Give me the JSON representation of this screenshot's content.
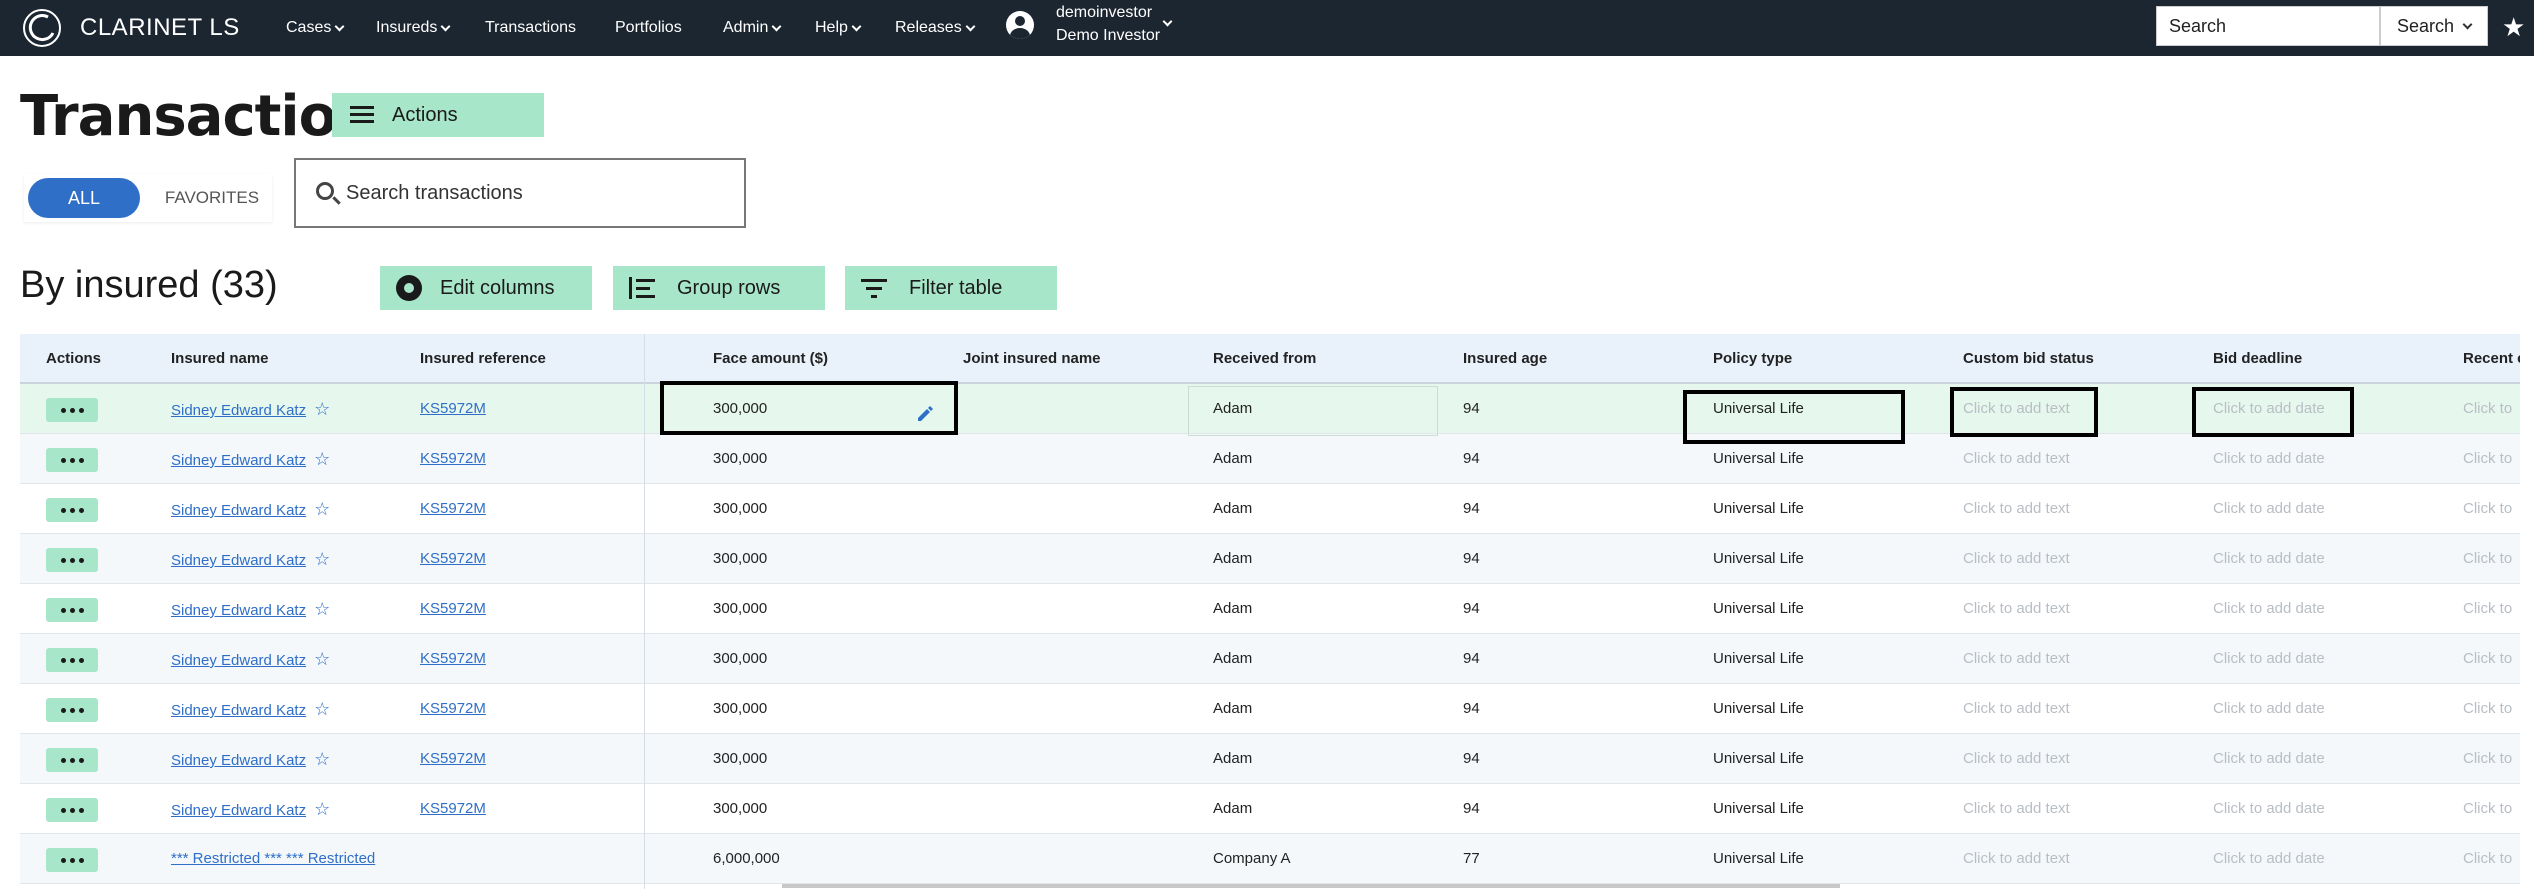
{
  "app": {
    "brand": "CLARINET LS"
  },
  "nav": {
    "items": [
      {
        "label": "Cases",
        "has_dropdown": true
      },
      {
        "label": "Insureds",
        "has_dropdown": true
      },
      {
        "label": "Transactions",
        "has_dropdown": false
      },
      {
        "label": "Portfolios",
        "has_dropdown": false
      },
      {
        "label": "Admin",
        "has_dropdown": true
      },
      {
        "label": "Help",
        "has_dropdown": true
      },
      {
        "label": "Releases",
        "has_dropdown": true
      }
    ],
    "user": {
      "username": "demoinvestor",
      "display_name": "Demo Investor"
    },
    "search": {
      "value": "Search",
      "button_label": "Search"
    }
  },
  "page": {
    "title": "Transactions",
    "actions_label": "Actions",
    "tabs": [
      {
        "label": "ALL",
        "active": true
      },
      {
        "label": "FAVORITES",
        "active": false
      }
    ],
    "search_placeholder": "Search transactions"
  },
  "section": {
    "title": "By insured (33)",
    "buttons": {
      "edit_columns": "Edit columns",
      "group_rows": "Group rows",
      "filter_table": "Filter table"
    }
  },
  "table": {
    "columns": [
      "Actions",
      "Insured name",
      "Insured reference",
      "Face amount ($)",
      "Joint insured name",
      "Received from",
      "Insured age",
      "Policy type",
      "Custom bid status",
      "Bid deadline",
      "Recent c"
    ],
    "placeholders": {
      "text": "Click to add text",
      "date": "Click to add date",
      "recent": "Click to"
    },
    "rows": [
      {
        "insured_name": "Sidney Edward Katz",
        "reference": "KS5972M",
        "face_amount": "300,000",
        "joint": "",
        "received_from": "Adam",
        "age": "94",
        "policy_type": "Universal Life"
      },
      {
        "insured_name": "Sidney Edward Katz",
        "reference": "KS5972M",
        "face_amount": "300,000",
        "joint": "",
        "received_from": "Adam",
        "age": "94",
        "policy_type": "Universal Life"
      },
      {
        "insured_name": "Sidney Edward Katz",
        "reference": "KS5972M",
        "face_amount": "300,000",
        "joint": "",
        "received_from": "Adam",
        "age": "94",
        "policy_type": "Universal Life"
      },
      {
        "insured_name": "Sidney Edward Katz",
        "reference": "KS5972M",
        "face_amount": "300,000",
        "joint": "",
        "received_from": "Adam",
        "age": "94",
        "policy_type": "Universal Life"
      },
      {
        "insured_name": "Sidney Edward Katz",
        "reference": "KS5972M",
        "face_amount": "300,000",
        "joint": "",
        "received_from": "Adam",
        "age": "94",
        "policy_type": "Universal Life"
      },
      {
        "insured_name": "Sidney Edward Katz",
        "reference": "KS5972M",
        "face_amount": "300,000",
        "joint": "",
        "received_from": "Adam",
        "age": "94",
        "policy_type": "Universal Life"
      },
      {
        "insured_name": "Sidney Edward Katz",
        "reference": "KS5972M",
        "face_amount": "300,000",
        "joint": "",
        "received_from": "Adam",
        "age": "94",
        "policy_type": "Universal Life"
      },
      {
        "insured_name": "Sidney Edward Katz",
        "reference": "KS5972M",
        "face_amount": "300,000",
        "joint": "",
        "received_from": "Adam",
        "age": "94",
        "policy_type": "Universal Life"
      },
      {
        "insured_name": "Sidney Edward Katz",
        "reference": "KS5972M",
        "face_amount": "300,000",
        "joint": "",
        "received_from": "Adam",
        "age": "94",
        "policy_type": "Universal Life"
      },
      {
        "insured_name": "*** Restricted *** *** Restricted",
        "reference": "",
        "face_amount": "6,000,000",
        "joint": "",
        "received_from": "Company A",
        "age": "77",
        "policy_type": "Universal Life"
      }
    ]
  },
  "colors": {
    "topbar": "#1b2631",
    "accent_green": "#a8e6c9",
    "link_blue": "#2f6fc7",
    "header_bg": "#e9f2fb"
  }
}
